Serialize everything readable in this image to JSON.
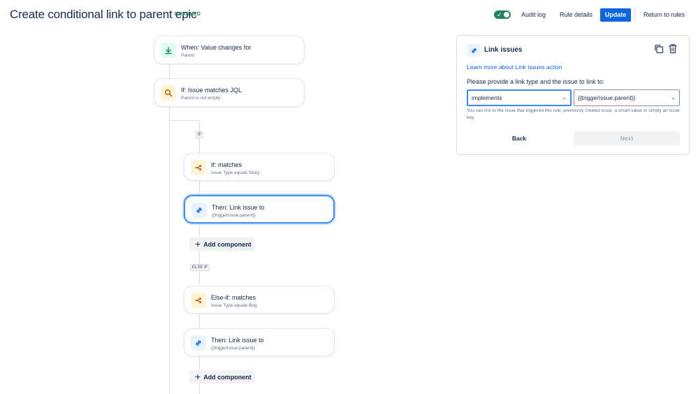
{
  "header": {
    "title": "Create conditional link to parent epic",
    "status_badge": "ENABLED",
    "enabled_toggle": true,
    "audit_log": "Audit log",
    "rule_details": "Rule details",
    "update": "Update",
    "return_to_rules": "Return to rules"
  },
  "flow": {
    "trigger": {
      "title": "When: Value changes for",
      "subtitle": "Parent",
      "icon": "download-arrow-icon"
    },
    "condition": {
      "title": "If: Issue matches JQL",
      "subtitle": "Parent is not empty",
      "icon": "search-icon"
    },
    "if_branch_label": "IF",
    "if_block": {
      "condition": {
        "title": "If: matches",
        "subtitle": "Issue Type equals Story",
        "icon": "branch-icon"
      },
      "action": {
        "title": "Then: Link issue to",
        "subtitle": "{{triggerIssue.parent}}",
        "icon": "link-icon"
      },
      "add_component": "Add component"
    },
    "else_if_branch_label": "ELSE IF",
    "else_if_block": {
      "condition": {
        "title": "Else-if: matches",
        "subtitle": "Issue Type equals Bug",
        "icon": "branch-icon"
      },
      "action": {
        "title": "Then: Link issue to",
        "subtitle": "{{triggerIssue.parent}}",
        "icon": "link-icon"
      },
      "add_component": "Add component"
    }
  },
  "panel": {
    "title": "Link issues",
    "learn_more": "Learn more about Link issues action",
    "prompt": "Please provide a link type and the issue to link to:",
    "link_type_value": "implements",
    "issue_value": "{{triggerIssue.parent}}",
    "help_text": "You can link to the issue that triggered this rule, previously created issue, a smart-value or simply an issue key.",
    "back": "Back",
    "next": "Next"
  },
  "colors": {
    "accent": "#0c66e4",
    "enabled": "#1f845a",
    "selected_border": "#388bff"
  }
}
